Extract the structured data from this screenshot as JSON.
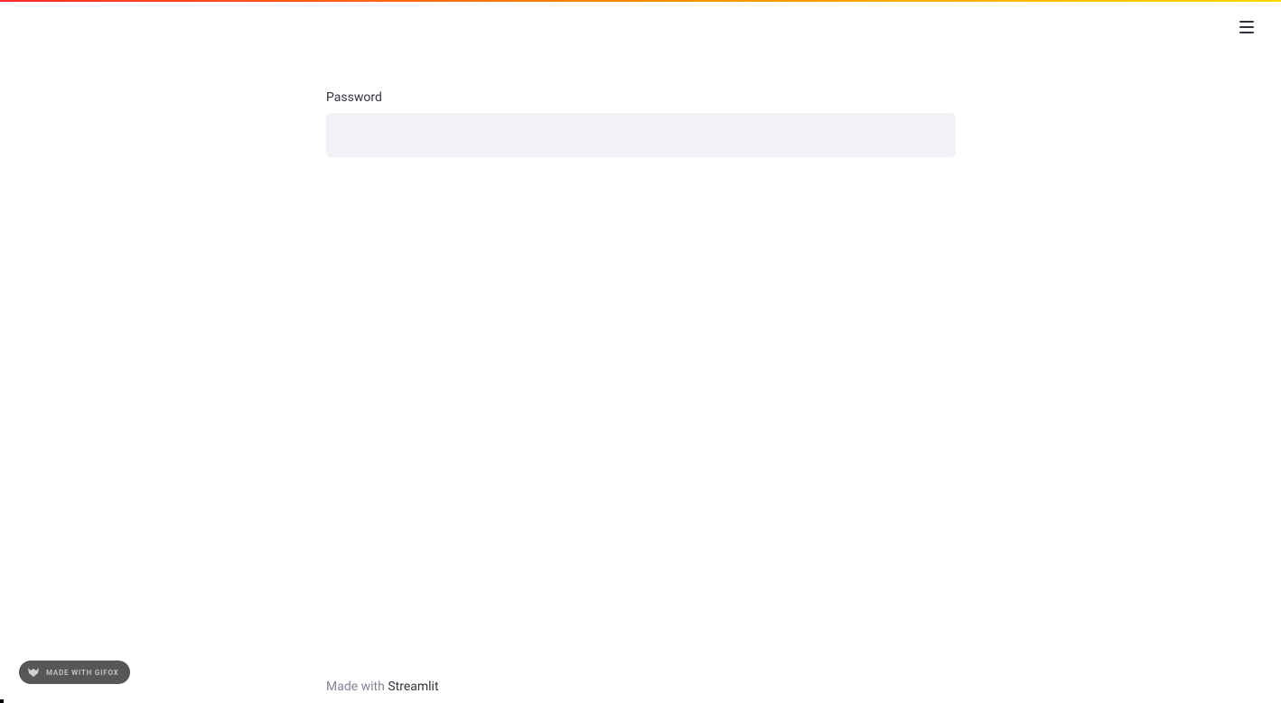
{
  "form": {
    "password_label": "Password",
    "password_value": ""
  },
  "footer": {
    "made_with": "Made with ",
    "brand": "Streamlit"
  },
  "badge": {
    "text": "MADE WITH GIFOX"
  }
}
